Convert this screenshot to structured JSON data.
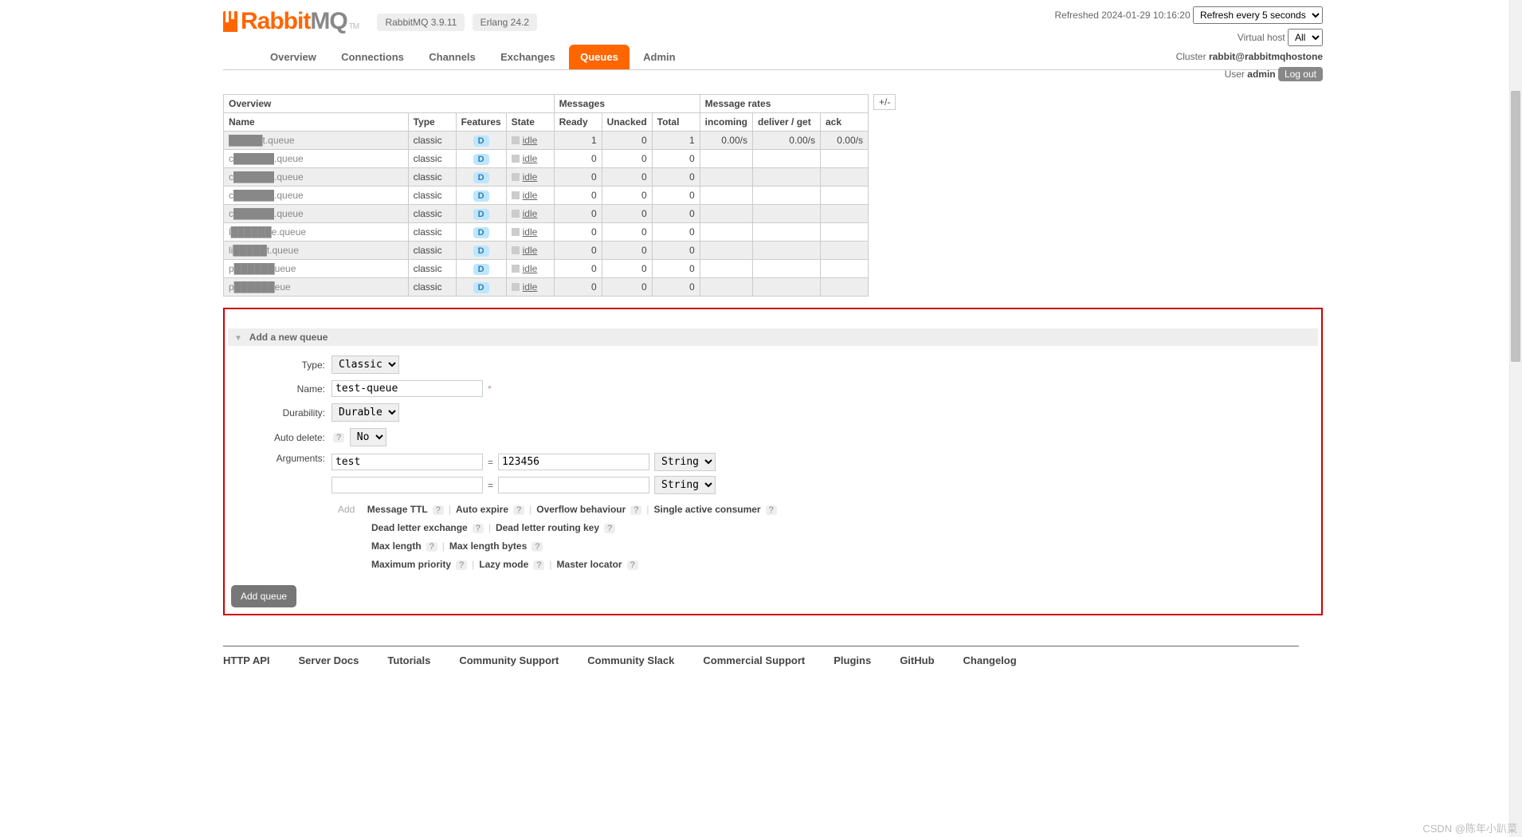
{
  "logo": {
    "brand": "Rabbit",
    "suffix": "MQ",
    "tm": "TM"
  },
  "versions": {
    "rabbit": "RabbitMQ 3.9.11",
    "erlang": "Erlang 24.2"
  },
  "top_right": {
    "refreshed_label": "Refreshed",
    "refreshed_time": "2024-01-29 10:16:20",
    "refresh_select": "Refresh every 5 seconds",
    "vhost_label": "Virtual host",
    "vhost_select": "All",
    "cluster_label": "Cluster",
    "cluster_value": "rabbit@rabbitmqhostone",
    "user_label": "User",
    "user_value": "admin",
    "logout": "Log out"
  },
  "nav": [
    "Overview",
    "Connections",
    "Channels",
    "Exchanges",
    "Queues",
    "Admin"
  ],
  "nav_active": 4,
  "table": {
    "group_headers": [
      "Overview",
      "Messages",
      "Message rates"
    ],
    "toggle": "+/-",
    "headers": [
      "Name",
      "Type",
      "Features",
      "State",
      "Ready",
      "Unacked",
      "Total",
      "incoming",
      "deliver / get",
      "ack"
    ],
    "rows": [
      {
        "name": "█████t.queue",
        "type": "classic",
        "feature": "D",
        "state": "idle",
        "ready": "1",
        "unacked": "0",
        "total": "1",
        "incoming": "0.00/s",
        "deliver": "0.00/s",
        "ack": "0.00/s"
      },
      {
        "name": "c██████.queue",
        "type": "classic",
        "feature": "D",
        "state": "idle",
        "ready": "0",
        "unacked": "0",
        "total": "0",
        "incoming": "",
        "deliver": "",
        "ack": ""
      },
      {
        "name": "c██████.queue",
        "type": "classic",
        "feature": "D",
        "state": "idle",
        "ready": "0",
        "unacked": "0",
        "total": "0",
        "incoming": "",
        "deliver": "",
        "ack": ""
      },
      {
        "name": "c██████.queue",
        "type": "classic",
        "feature": "D",
        "state": "idle",
        "ready": "0",
        "unacked": "0",
        "total": "0",
        "incoming": "",
        "deliver": "",
        "ack": ""
      },
      {
        "name": "c██████.queue",
        "type": "classic",
        "feature": "D",
        "state": "idle",
        "ready": "0",
        "unacked": "0",
        "total": "0",
        "incoming": "",
        "deliver": "",
        "ack": ""
      },
      {
        "name": "l██████e.queue",
        "type": "classic",
        "feature": "D",
        "state": "idle",
        "ready": "0",
        "unacked": "0",
        "total": "0",
        "incoming": "",
        "deliver": "",
        "ack": ""
      },
      {
        "name": "li█████t.queue",
        "type": "classic",
        "feature": "D",
        "state": "idle",
        "ready": "0",
        "unacked": "0",
        "total": "0",
        "incoming": "",
        "deliver": "",
        "ack": ""
      },
      {
        "name": "p██████ueue",
        "type": "classic",
        "feature": "D",
        "state": "idle",
        "ready": "0",
        "unacked": "0",
        "total": "0",
        "incoming": "",
        "deliver": "",
        "ack": ""
      },
      {
        "name": "p██████eue",
        "type": "classic",
        "feature": "D",
        "state": "idle",
        "ready": "0",
        "unacked": "0",
        "total": "0",
        "incoming": "",
        "deliver": "",
        "ack": ""
      }
    ]
  },
  "add_queue": {
    "title": "Add a new queue",
    "labels": {
      "type": "Type:",
      "name": "Name:",
      "durability": "Durability:",
      "auto_delete": "Auto delete:",
      "arguments": "Arguments:"
    },
    "type_select": "Classic",
    "name_value": "test-queue",
    "durability_select": "Durable",
    "auto_delete_select": "No",
    "args": [
      {
        "key": "test",
        "value": "123456",
        "type": "String"
      },
      {
        "key": "",
        "value": "",
        "type": "String"
      }
    ],
    "add_label": "Add",
    "hints_row1": [
      "Message TTL",
      "Auto expire",
      "Overflow behaviour",
      "Single active consumer"
    ],
    "hints_row2": [
      "Dead letter exchange",
      "Dead letter routing key"
    ],
    "hints_row3": [
      "Max length",
      "Max length bytes"
    ],
    "hints_row4": [
      "Maximum priority",
      "Lazy mode",
      "Master locator"
    ],
    "button": "Add queue"
  },
  "footer": [
    "HTTP API",
    "Server Docs",
    "Tutorials",
    "Community Support",
    "Community Slack",
    "Commercial Support",
    "Plugins",
    "GitHub",
    "Changelog"
  ],
  "watermark": "CSDN @陈年小趴菜"
}
